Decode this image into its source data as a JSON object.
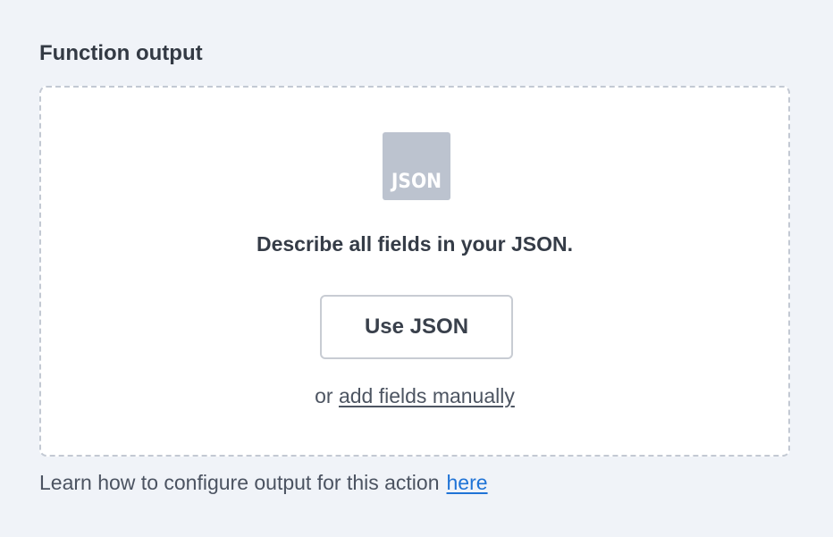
{
  "section": {
    "title": "Function output"
  },
  "dropzone": {
    "icon_name": "json-file-icon",
    "icon_text": "JSON",
    "message": "Describe all fields in your JSON.",
    "primary_button": "Use JSON",
    "alt_prefix": "or",
    "alt_link": "add fields manually"
  },
  "help": {
    "text": "Learn how to configure output for this action",
    "link": "here"
  },
  "colors": {
    "background": "#f0f3f8",
    "link": "#1f73d6",
    "icon_fill": "#bcc3cf"
  }
}
